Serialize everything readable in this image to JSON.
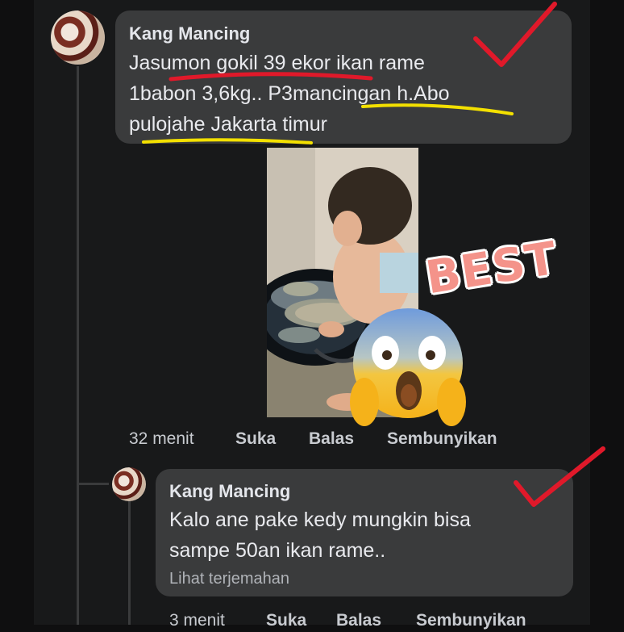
{
  "comments": [
    {
      "author": "Kang Mancing",
      "lines": [
        "Jasumon gokil 39 ekor ikan rame",
        "1babon 3,6kg.. P3mancingan h.Abo",
        "pulojahe Jakarta timur"
      ],
      "time": "32 menit",
      "actions": [
        "Suka",
        "Balas",
        "Sembunyikan"
      ],
      "has_photo": true
    },
    {
      "author": "Kang Mancing",
      "lines": [
        "Kalo ane pake kedy mungkin bisa",
        "sampe 50an ikan rame.."
      ],
      "translate_link": "Lihat terjemahan",
      "time": "3 menit",
      "actions": [
        "Suka",
        "Balas",
        "Sembunyikan"
      ]
    }
  ],
  "overlay": {
    "sticker_text": "BEST",
    "sticker_color": "#f4938a",
    "checkmark_color": "#e0192a",
    "underline_red": "#e0192a",
    "underline_yellow": "#f3e000",
    "emoji": "face-screaming-in-fear"
  }
}
